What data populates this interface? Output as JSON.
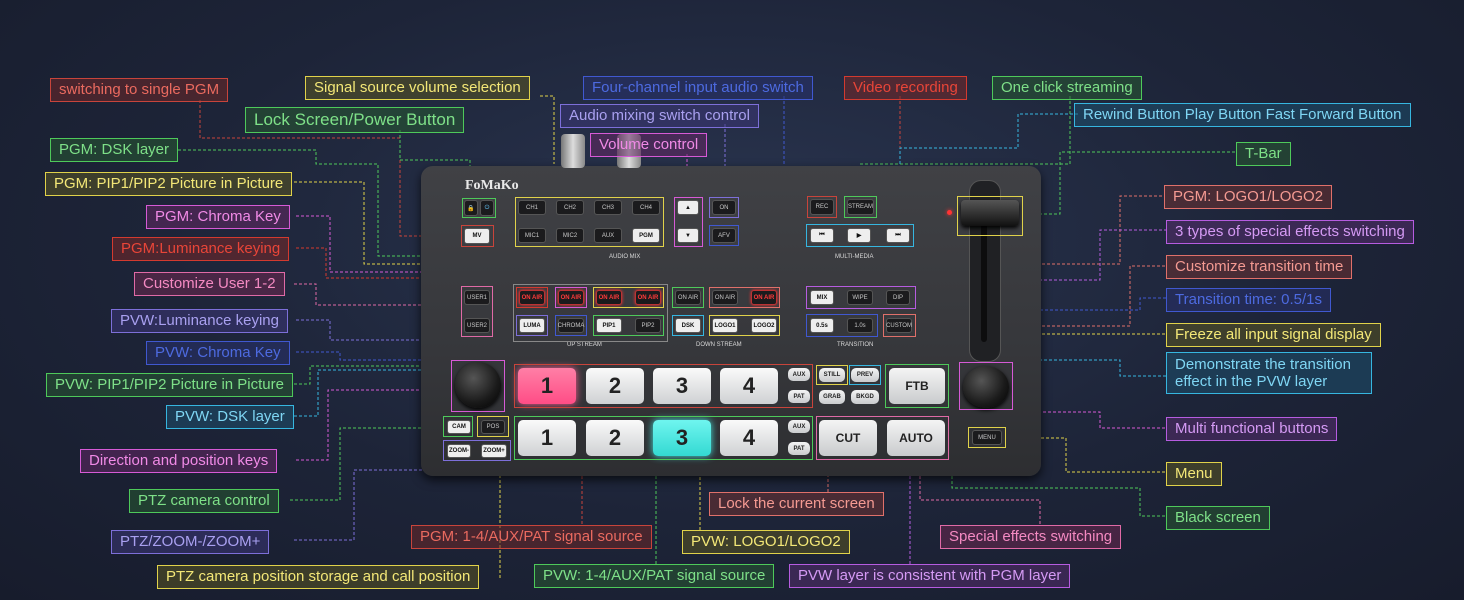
{
  "device": {
    "brand": "FoMaKo",
    "sections": {
      "audio_mix": "AUDIO MIX",
      "multi_media": "MULTI-MEDIA",
      "up_stream": "UP STREAM",
      "down_stream": "DOWN STREAM",
      "transition": "TRANSITION"
    },
    "buttons": {
      "mv": "MV",
      "ch1": "CH1",
      "ch2": "CH2",
      "ch3": "CH3",
      "ch4": "CH4",
      "mic1": "MIC1",
      "mic2": "MIC2",
      "aux": "AUX",
      "pgm": "PGM",
      "on": "ON",
      "afv": "AFV",
      "rec": "REC",
      "stream": "STREAM",
      "user1": "USER1",
      "user2": "USER2",
      "on_air": "ON AIR",
      "luma": "LUMA",
      "chroma": "CHROMA",
      "pip1": "PIP1",
      "pip2": "PIP2",
      "dsk": "DSK",
      "logo1": "LOGO1",
      "logo2": "LOGO2",
      "mix": "MIX",
      "wipe": "WIPE",
      "dip": "DIP",
      "t05": "0.5s",
      "t10": "1.0s",
      "custom": "CUSTOM",
      "n1": "1",
      "n2": "2",
      "n3": "3",
      "n4": "4",
      "pat": "PAT",
      "still": "STILL",
      "prev": "PREV",
      "grab": "GRAB",
      "bkgd": "BKGD",
      "ftb": "FTB",
      "cut": "CUT",
      "auto": "AUTO",
      "menu": "MENU",
      "cam": "CAM",
      "pos": "POS",
      "zoom_minus": "ZOOM-",
      "zoom_plus": "ZOOM+"
    }
  },
  "labels": {
    "single_pgm": "switching to single PGM",
    "signal_volume": "Signal source volume selection",
    "four_channel": "Four-channel input audio switch",
    "video_recording": "Video recording",
    "one_click": "One click streaming",
    "rewind": "Rewind Button Play Button Fast Forward Button",
    "lock_power": "Lock Screen/Power Button",
    "audio_mixing": "Audio mixing switch control",
    "volume_control": "Volume control",
    "pgm_dsk": "PGM: DSK layer",
    "t_bar": "T-Bar",
    "pgm_pip": "PGM: PIP1/PIP2 Picture in Picture",
    "pgm_logo": "PGM: LOGO1/LOGO2",
    "pgm_chroma": "PGM: Chroma Key",
    "three_types": "3 types of special effects switching",
    "pgm_luma": "PGM:Luminance keying",
    "custom_time": "Customize transition time",
    "user12": "Customize User 1-2",
    "trans_time": "Transition time: 0.5/1s",
    "pvw_luma": "PVW:Luminance keying",
    "freeze": "Freeze all input signal display",
    "pvw_chroma": "PVW: Chroma Key",
    "demonstrate": "Demonstrate the transition effect in the PVW layer",
    "pvw_pip": "PVW: PIP1/PIP2 Picture in Picture",
    "pvw_dsk": "PVW: DSK layer",
    "multi_func": "Multi functional buttons",
    "direction": "Direction and position keys",
    "menu": "Menu",
    "ptz_control": "PTZ camera control",
    "lock_current": "Lock the current screen",
    "black_screen": "Black screen",
    "pgm_source": "PGM: 1-4/AUX/PAT signal source",
    "special_switch": "Special effects switching",
    "ptz_zoom": "PTZ/ZOOM-/ZOOM+",
    "pvw_logo": "PVW: LOGO1/LOGO2",
    "ptz_storage": "PTZ camera position storage and call position",
    "pvw_source": "PVW: 1-4/AUX/PAT signal source",
    "pvw_consistent": "PVW layer is consistent with PGM layer"
  }
}
